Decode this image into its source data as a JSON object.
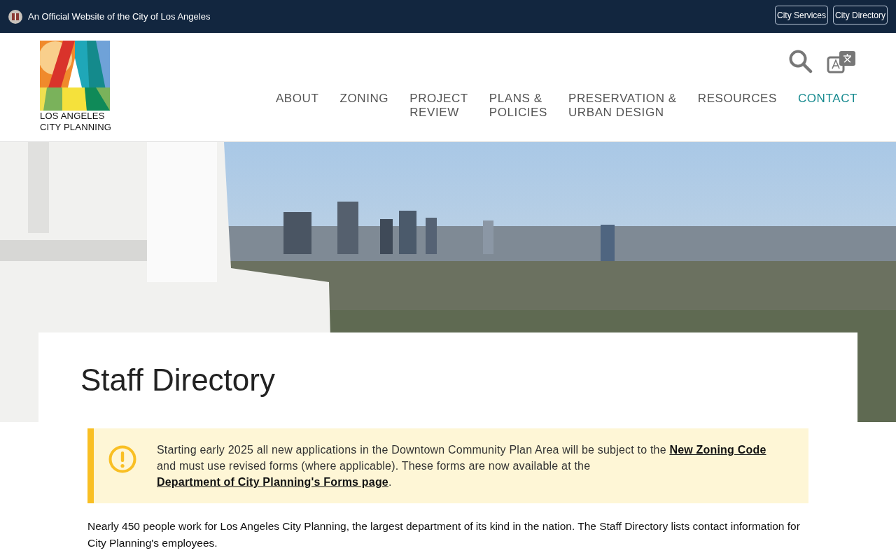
{
  "top_bar": {
    "official_text": "An Official Website of the City of Los Angeles",
    "links": [
      "City Services",
      "City Directory"
    ]
  },
  "logo": {
    "lines": [
      "LOS ANGELES",
      "CITY PLANNING"
    ]
  },
  "nav": [
    {
      "lines": [
        "ABOUT"
      ],
      "selected": false
    },
    {
      "lines": [
        "ZONING"
      ],
      "selected": false
    },
    {
      "lines": [
        "PROJECT",
        "REVIEW"
      ],
      "selected": false
    },
    {
      "lines": [
        "PLANS &",
        "POLICIES"
      ],
      "selected": false
    },
    {
      "lines": [
        "PRESERVATION &",
        "URBAN DESIGN"
      ],
      "selected": false
    },
    {
      "lines": [
        "RESOURCES"
      ],
      "selected": false
    },
    {
      "lines": [
        "CONTACT"
      ],
      "selected": true
    }
  ],
  "page_title": "Staff Directory",
  "notice": {
    "segments": [
      {
        "text": "Starting early 2025 all new applications in the Downtown Community Plan Area will be subject to the ",
        "link": false
      },
      {
        "text": "New Zoning Code",
        "link": true
      },
      {
        "text": " and must use revised forms (where applicable). These forms are now available at the ",
        "link": false
      },
      {
        "text": "Department of City Planning's Forms page",
        "link": true
      },
      {
        "text": ".",
        "link": false
      }
    ]
  },
  "intro": "Nearly 450 people work for Los Angeles City Planning, the largest department of its kind in the nation. The Staff Directory lists contact information for City Planning's employees."
}
